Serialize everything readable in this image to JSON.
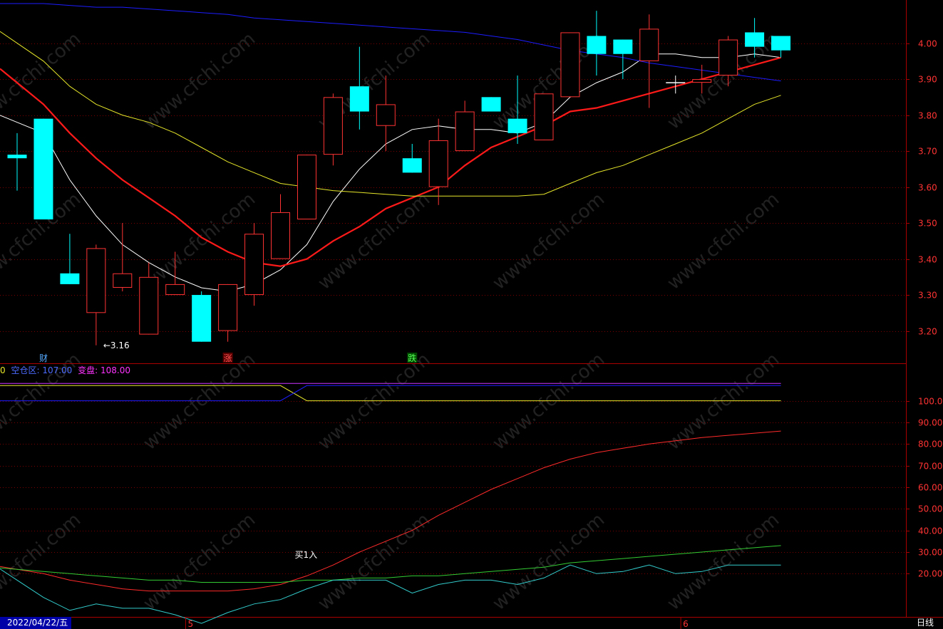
{
  "chart_data": [
    {
      "type": "candlestick",
      "ylim": [
        3.11,
        4.12
      ],
      "yticks": [
        "4.00",
        "3.90",
        "3.80",
        "3.70",
        "3.60",
        "3.50",
        "3.40",
        "3.30",
        "3.20"
      ],
      "candles": [
        {
          "o": 3.69,
          "h": 3.75,
          "l": 3.59,
          "c": 3.68
        },
        {
          "o": 3.79,
          "h": 3.79,
          "l": 3.51,
          "c": 3.51
        },
        {
          "o": 3.36,
          "h": 3.47,
          "l": 3.33,
          "c": 3.33
        },
        {
          "o": 3.25,
          "h": 3.44,
          "l": 3.16,
          "c": 3.43
        },
        {
          "o": 3.32,
          "h": 3.5,
          "l": 3.31,
          "c": 3.36
        },
        {
          "o": 3.19,
          "h": 3.39,
          "l": 3.19,
          "c": 3.35
        },
        {
          "o": 3.3,
          "h": 3.42,
          "l": 3.3,
          "c": 3.33
        },
        {
          "o": 3.3,
          "h": 3.31,
          "l": 3.17,
          "c": 3.17
        },
        {
          "o": 3.2,
          "h": 3.33,
          "l": 3.17,
          "c": 3.33
        },
        {
          "o": 3.3,
          "h": 3.5,
          "l": 3.27,
          "c": 3.47
        },
        {
          "o": 3.4,
          "h": 3.58,
          "l": 3.4,
          "c": 3.53
        },
        {
          "o": 3.51,
          "h": 3.69,
          "l": 3.51,
          "c": 3.69
        },
        {
          "o": 3.69,
          "h": 3.86,
          "l": 3.66,
          "c": 3.85
        },
        {
          "o": 3.88,
          "h": 3.99,
          "l": 3.76,
          "c": 3.81
        },
        {
          "o": 3.77,
          "h": 3.91,
          "l": 3.7,
          "c": 3.83
        },
        {
          "o": 3.68,
          "h": 3.72,
          "l": 3.64,
          "c": 3.64
        },
        {
          "o": 3.6,
          "h": 3.79,
          "l": 3.55,
          "c": 3.73
        },
        {
          "o": 3.7,
          "h": 3.84,
          "l": 3.7,
          "c": 3.81
        },
        {
          "o": 3.85,
          "h": 3.85,
          "l": 3.81,
          "c": 3.81
        },
        {
          "o": 3.79,
          "h": 3.91,
          "l": 3.72,
          "c": 3.75
        },
        {
          "o": 3.73,
          "h": 3.86,
          "l": 3.73,
          "c": 3.86
        },
        {
          "o": 3.85,
          "h": 4.03,
          "l": 3.85,
          "c": 4.03
        },
        {
          "o": 4.02,
          "h": 4.09,
          "l": 3.91,
          "c": 3.97
        },
        {
          "o": 4.01,
          "h": 4.01,
          "l": 3.9,
          "c": 3.97
        },
        {
          "o": 3.95,
          "h": 4.08,
          "l": 3.82,
          "c": 4.04
        },
        {
          "o": 3.89,
          "h": 3.91,
          "l": 3.86,
          "c": 3.89
        },
        {
          "o": 3.89,
          "h": 3.94,
          "l": 3.86,
          "c": 3.9
        },
        {
          "o": 3.91,
          "h": 4.02,
          "l": 3.88,
          "c": 4.01
        },
        {
          "o": 4.03,
          "h": 4.07,
          "l": 3.96,
          "c": 3.99
        },
        {
          "o": 4.02,
          "h": 4.02,
          "l": 3.96,
          "c": 3.98
        }
      ],
      "ma_lines": [
        {
          "color": "#ffffff",
          "values": [
            3.78,
            3.75,
            3.62,
            3.52,
            3.44,
            3.39,
            3.35,
            3.32,
            3.31,
            3.33,
            3.37,
            3.44,
            3.56,
            3.65,
            3.72,
            3.76,
            3.77,
            3.76,
            3.76,
            3.75,
            3.78,
            3.85,
            3.89,
            3.92,
            3.97,
            3.97,
            3.96,
            3.96,
            3.97,
            3.96
          ]
        },
        {
          "color": "#ff1a1a",
          "values": [
            3.89,
            3.83,
            3.75,
            3.68,
            3.62,
            3.57,
            3.52,
            3.46,
            3.42,
            3.39,
            3.38,
            3.4,
            3.45,
            3.49,
            3.54,
            3.57,
            3.6,
            3.66,
            3.71,
            3.74,
            3.77,
            3.81,
            3.82,
            3.84,
            3.86,
            3.88,
            3.9,
            3.92,
            3.94,
            3.96
          ]
        },
        {
          "color": "#e6e62a",
          "values": [
            4.0,
            3.95,
            3.88,
            3.83,
            3.8,
            3.78,
            3.75,
            3.71,
            3.67,
            3.64,
            3.61,
            3.6,
            3.59,
            3.585,
            3.58,
            3.575,
            3.575,
            3.575,
            3.575,
            3.575,
            3.58,
            3.61,
            3.64,
            3.66,
            3.69,
            3.72,
            3.75,
            3.79,
            3.83,
            3.855
          ]
        },
        {
          "color": "#1c1cff",
          "values": [
            4.11,
            4.11,
            4.105,
            4.1,
            4.1,
            4.095,
            4.09,
            4.085,
            4.08,
            4.07,
            4.065,
            4.06,
            4.055,
            4.05,
            4.045,
            4.04,
            4.035,
            4.03,
            4.02,
            4.01,
            3.995,
            3.98,
            3.97,
            3.96,
            3.945,
            3.935,
            3.925,
            3.915,
            3.905,
            3.895
          ]
        }
      ],
      "markers": [
        {
          "index": 1,
          "text": "财",
          "color": "#55aaff"
        },
        {
          "index": 8,
          "text": "涨",
          "color": "#ff5555",
          "bg": "#5a0000"
        },
        {
          "index": 15,
          "text": "跌",
          "color": "#55ff55",
          "bg": "#004a00"
        }
      ],
      "low_annotation": {
        "index": 3,
        "text": "←3.16"
      }
    },
    {
      "type": "line",
      "ylim": [
        0,
        117
      ],
      "yticks": [
        "100.00",
        "90.00",
        "80.00",
        "70.00",
        "60.00",
        "50.00",
        "40.00",
        "30.00",
        "20.00"
      ],
      "legend": [
        {
          "text": "0",
          "color": "#e6e62a"
        },
        {
          "text": "空仓区: 107.00",
          "color": "#4d6bff"
        },
        {
          "text": "变盘: 108.00",
          "color": "#ff33ff"
        }
      ],
      "series": [
        {
          "color": "#e6e62a",
          "values": [
            107,
            107,
            107,
            107,
            107,
            107,
            107,
            107,
            107,
            107,
            107,
            100,
            100,
            100,
            100,
            100,
            100,
            100,
            100,
            100,
            100,
            100,
            100,
            100,
            100,
            100,
            100,
            100,
            100,
            100
          ]
        },
        {
          "color": "#1c1cff",
          "values": [
            100,
            100,
            100,
            100,
            100,
            100,
            100,
            100,
            100,
            100,
            100,
            107,
            107,
            107,
            107,
            107,
            107,
            107,
            107,
            107,
            107,
            107,
            107,
            107,
            107,
            107,
            107,
            107,
            107,
            107
          ]
        },
        {
          "color": "#cc33ff",
          "values": [
            108,
            108,
            108,
            108,
            108,
            108,
            108,
            108,
            108,
            108,
            108,
            108,
            108,
            108,
            108,
            108,
            108,
            108,
            108,
            108,
            108,
            108,
            108,
            108,
            108,
            108,
            108,
            108,
            108,
            108
          ]
        },
        {
          "color": "#ff2a2a",
          "values": [
            22,
            20,
            17,
            15,
            13,
            12,
            12,
            12,
            12,
            13,
            15,
            19,
            24,
            30,
            35,
            40,
            47,
            53,
            59,
            64,
            69,
            73,
            76,
            78,
            80,
            81.5,
            83,
            84,
            85,
            86
          ]
        },
        {
          "color": "#33cc33",
          "values": [
            22,
            21,
            20,
            19,
            18,
            17,
            17,
            16,
            16,
            16,
            16,
            17,
            17,
            18,
            18,
            19,
            19,
            20,
            21,
            22,
            23,
            25,
            26,
            27,
            28,
            29,
            30,
            31,
            32,
            33
          ]
        },
        {
          "color": "#33cccc",
          "values": [
            17,
            9,
            3,
            6,
            4,
            4,
            1,
            -3,
            2,
            6,
            8,
            13,
            17,
            17,
            17,
            11,
            15,
            17,
            17,
            15,
            18,
            24,
            20,
            21,
            24,
            20,
            21,
            24,
            24,
            24
          ]
        }
      ],
      "annotation": {
        "index": 11,
        "value": 24,
        "text": "买1入"
      }
    }
  ],
  "x_axis": {
    "date": "2022/04/22/五",
    "month_labels": [
      {
        "index": 6.4,
        "text": "5"
      },
      {
        "index": 25.2,
        "text": "6"
      }
    ]
  },
  "period_label": "日线",
  "watermark": "www.cfchi.com"
}
